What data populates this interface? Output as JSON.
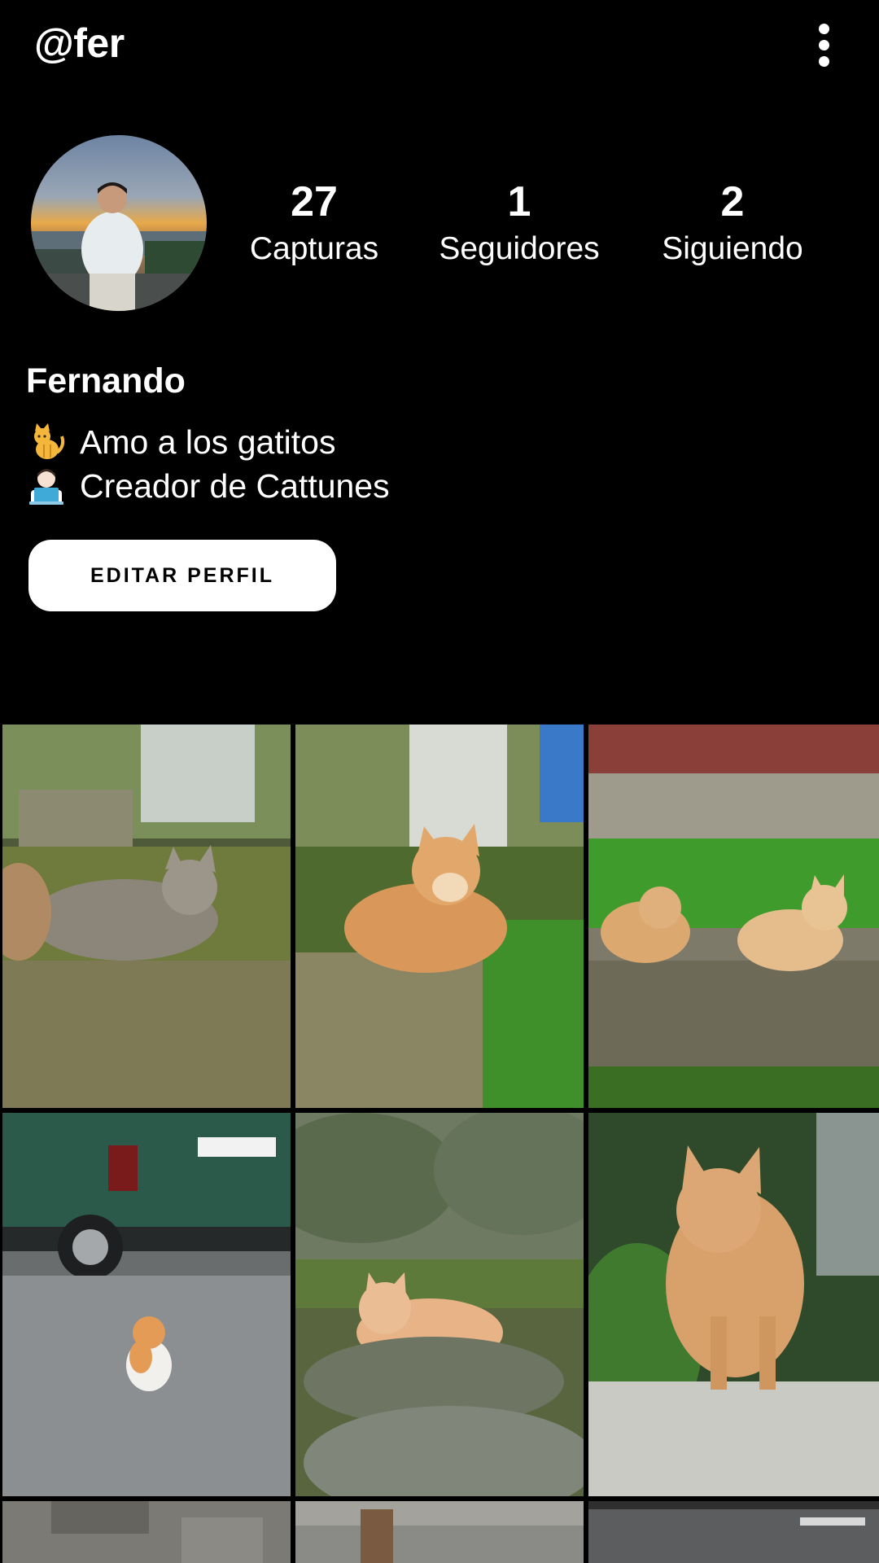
{
  "header": {
    "username": "@fer",
    "menu_icon": "more-vertical-icon"
  },
  "profile": {
    "avatar_icon": "profile-photo",
    "stats": [
      {
        "value": "27",
        "label": "Capturas"
      },
      {
        "value": "1",
        "label": "Seguidores"
      },
      {
        "value": "2",
        "label": "Siguiendo"
      }
    ],
    "display_name": "Fernando",
    "bio": [
      {
        "emoji": "cat-emoji",
        "text": "Amo a los gatitos"
      },
      {
        "emoji": "technologist-emoji",
        "text": "Creador de Cattunes"
      }
    ],
    "edit_button": "EDITAR PERFIL"
  },
  "grid": {
    "photos": [
      {
        "subject": "grey tabby cat on concrete wall"
      },
      {
        "subject": "orange cat on concrete block"
      },
      {
        "subject": "two orange cats on wall"
      },
      {
        "subject": "orange and white cat by green van"
      },
      {
        "subject": "orange cat on mossy rock"
      },
      {
        "subject": "fluffy orange cat on stone wall"
      },
      {
        "subject": "stone wall"
      },
      {
        "subject": "corrugated fence"
      },
      {
        "subject": "road"
      }
    ]
  },
  "colors": {
    "background": "#000000",
    "text": "#ffffff",
    "button_bg": "#ffffff",
    "button_text": "#000000"
  }
}
